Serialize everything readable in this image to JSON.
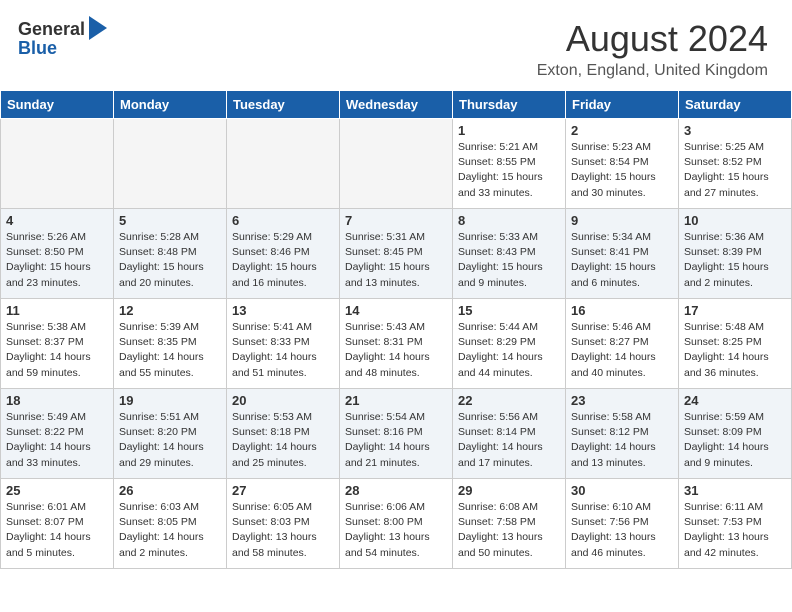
{
  "header": {
    "logo_general": "General",
    "logo_blue": "Blue",
    "month_year": "August 2024",
    "location": "Exton, England, United Kingdom"
  },
  "weekdays": [
    "Sunday",
    "Monday",
    "Tuesday",
    "Wednesday",
    "Thursday",
    "Friday",
    "Saturday"
  ],
  "weeks": [
    [
      {
        "day": "",
        "empty": true
      },
      {
        "day": "",
        "empty": true
      },
      {
        "day": "",
        "empty": true
      },
      {
        "day": "",
        "empty": true
      },
      {
        "day": "1",
        "sunrise": "5:21 AM",
        "sunset": "8:55 PM",
        "daylight": "15 hours and 33 minutes."
      },
      {
        "day": "2",
        "sunrise": "5:23 AM",
        "sunset": "8:54 PM",
        "daylight": "15 hours and 30 minutes."
      },
      {
        "day": "3",
        "sunrise": "5:25 AM",
        "sunset": "8:52 PM",
        "daylight": "15 hours and 27 minutes."
      }
    ],
    [
      {
        "day": "4",
        "sunrise": "5:26 AM",
        "sunset": "8:50 PM",
        "daylight": "15 hours and 23 minutes."
      },
      {
        "day": "5",
        "sunrise": "5:28 AM",
        "sunset": "8:48 PM",
        "daylight": "15 hours and 20 minutes."
      },
      {
        "day": "6",
        "sunrise": "5:29 AM",
        "sunset": "8:46 PM",
        "daylight": "15 hours and 16 minutes."
      },
      {
        "day": "7",
        "sunrise": "5:31 AM",
        "sunset": "8:45 PM",
        "daylight": "15 hours and 13 minutes."
      },
      {
        "day": "8",
        "sunrise": "5:33 AM",
        "sunset": "8:43 PM",
        "daylight": "15 hours and 9 minutes."
      },
      {
        "day": "9",
        "sunrise": "5:34 AM",
        "sunset": "8:41 PM",
        "daylight": "15 hours and 6 minutes."
      },
      {
        "day": "10",
        "sunrise": "5:36 AM",
        "sunset": "8:39 PM",
        "daylight": "15 hours and 2 minutes."
      }
    ],
    [
      {
        "day": "11",
        "sunrise": "5:38 AM",
        "sunset": "8:37 PM",
        "daylight": "14 hours and 59 minutes."
      },
      {
        "day": "12",
        "sunrise": "5:39 AM",
        "sunset": "8:35 PM",
        "daylight": "14 hours and 55 minutes."
      },
      {
        "day": "13",
        "sunrise": "5:41 AM",
        "sunset": "8:33 PM",
        "daylight": "14 hours and 51 minutes."
      },
      {
        "day": "14",
        "sunrise": "5:43 AM",
        "sunset": "8:31 PM",
        "daylight": "14 hours and 48 minutes."
      },
      {
        "day": "15",
        "sunrise": "5:44 AM",
        "sunset": "8:29 PM",
        "daylight": "14 hours and 44 minutes."
      },
      {
        "day": "16",
        "sunrise": "5:46 AM",
        "sunset": "8:27 PM",
        "daylight": "14 hours and 40 minutes."
      },
      {
        "day": "17",
        "sunrise": "5:48 AM",
        "sunset": "8:25 PM",
        "daylight": "14 hours and 36 minutes."
      }
    ],
    [
      {
        "day": "18",
        "sunrise": "5:49 AM",
        "sunset": "8:22 PM",
        "daylight": "14 hours and 33 minutes."
      },
      {
        "day": "19",
        "sunrise": "5:51 AM",
        "sunset": "8:20 PM",
        "daylight": "14 hours and 29 minutes."
      },
      {
        "day": "20",
        "sunrise": "5:53 AM",
        "sunset": "8:18 PM",
        "daylight": "14 hours and 25 minutes."
      },
      {
        "day": "21",
        "sunrise": "5:54 AM",
        "sunset": "8:16 PM",
        "daylight": "14 hours and 21 minutes."
      },
      {
        "day": "22",
        "sunrise": "5:56 AM",
        "sunset": "8:14 PM",
        "daylight": "14 hours and 17 minutes."
      },
      {
        "day": "23",
        "sunrise": "5:58 AM",
        "sunset": "8:12 PM",
        "daylight": "14 hours and 13 minutes."
      },
      {
        "day": "24",
        "sunrise": "5:59 AM",
        "sunset": "8:09 PM",
        "daylight": "14 hours and 9 minutes."
      }
    ],
    [
      {
        "day": "25",
        "sunrise": "6:01 AM",
        "sunset": "8:07 PM",
        "daylight": "14 hours and 5 minutes."
      },
      {
        "day": "26",
        "sunrise": "6:03 AM",
        "sunset": "8:05 PM",
        "daylight": "14 hours and 2 minutes."
      },
      {
        "day": "27",
        "sunrise": "6:05 AM",
        "sunset": "8:03 PM",
        "daylight": "13 hours and 58 minutes."
      },
      {
        "day": "28",
        "sunrise": "6:06 AM",
        "sunset": "8:00 PM",
        "daylight": "13 hours and 54 minutes."
      },
      {
        "day": "29",
        "sunrise": "6:08 AM",
        "sunset": "7:58 PM",
        "daylight": "13 hours and 50 minutes."
      },
      {
        "day": "30",
        "sunrise": "6:10 AM",
        "sunset": "7:56 PM",
        "daylight": "13 hours and 46 minutes."
      },
      {
        "day": "31",
        "sunrise": "6:11 AM",
        "sunset": "7:53 PM",
        "daylight": "13 hours and 42 minutes."
      }
    ]
  ],
  "labels": {
    "sunrise": "Sunrise:",
    "sunset": "Sunset:",
    "daylight": "Daylight:"
  }
}
